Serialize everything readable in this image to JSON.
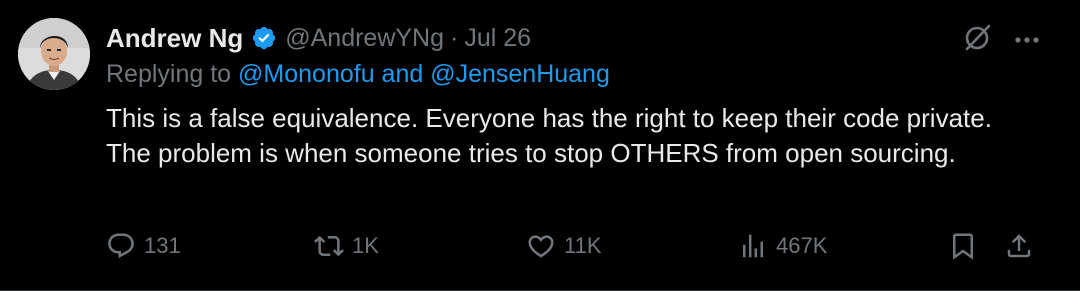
{
  "author": {
    "name": "Andrew Ng",
    "handle": "@AndrewYNg",
    "date": "Jul 26",
    "separator": "·"
  },
  "replying": {
    "prefix": "Replying to ",
    "mentions": "@Mononofu and @JensenHuang"
  },
  "tweet": {
    "text": "This is a false equivalence. Everyone has the right to keep their code private. The problem is when someone tries to stop OTHERS from open sourcing."
  },
  "metrics": {
    "replies": "131",
    "reposts": "1K",
    "likes": "11K",
    "views": "467K"
  },
  "icons": {
    "verified": "verified-badge-icon",
    "grok": "grok-icon",
    "more": "more-icon",
    "reply": "reply-icon",
    "repost": "repost-icon",
    "like": "heart-icon",
    "views": "views-icon",
    "bookmark": "bookmark-icon",
    "share": "share-icon"
  },
  "colors": {
    "background": "#000000",
    "text": "#e7e9ea",
    "muted": "#71767b",
    "accent": "#1d9bf0"
  }
}
